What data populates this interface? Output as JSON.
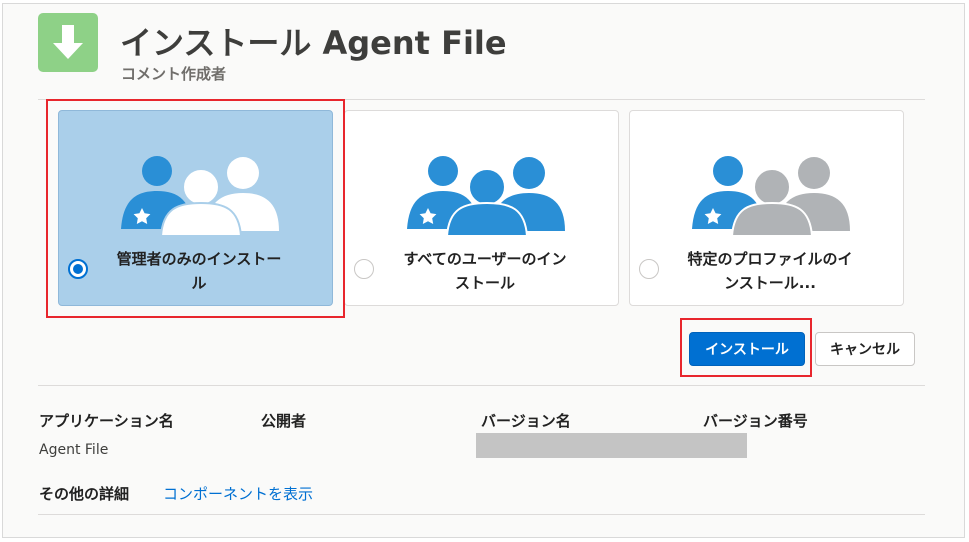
{
  "header": {
    "app_icon": "download-arrow-icon",
    "title": "インストール Agent File",
    "subtitle": "コメント作成者"
  },
  "install_options": [
    {
      "label_line1": "管理者のみのインストー",
      "label_line2": "ル",
      "selected": true,
      "icon": "users-admin-icon"
    },
    {
      "label_line1": "すべてのユーザーのイン",
      "label_line2": "ストール",
      "selected": false,
      "icon": "users-all-icon"
    },
    {
      "label_line1": "特定のプロファイルのイ",
      "label_line2": "ンストール...",
      "selected": false,
      "icon": "users-profile-icon"
    }
  ],
  "actions": {
    "install_label": "インストール",
    "cancel_label": "キャンセル"
  },
  "details": {
    "headers": [
      "アプリケーション名",
      "公開者",
      "バージョン名",
      "バージョン番号"
    ],
    "app_name": "Agent File",
    "other_details_label": "その他の詳細",
    "view_components_link": "コンポーネントを表示"
  },
  "colors": {
    "accent": "#0070d2",
    "selected_card": "#aacfea",
    "people_blue": "#2a8fd6",
    "people_gray": "#b0b3b6",
    "highlight_red": "#e8262d",
    "app_icon_bg": "#8ed187"
  }
}
